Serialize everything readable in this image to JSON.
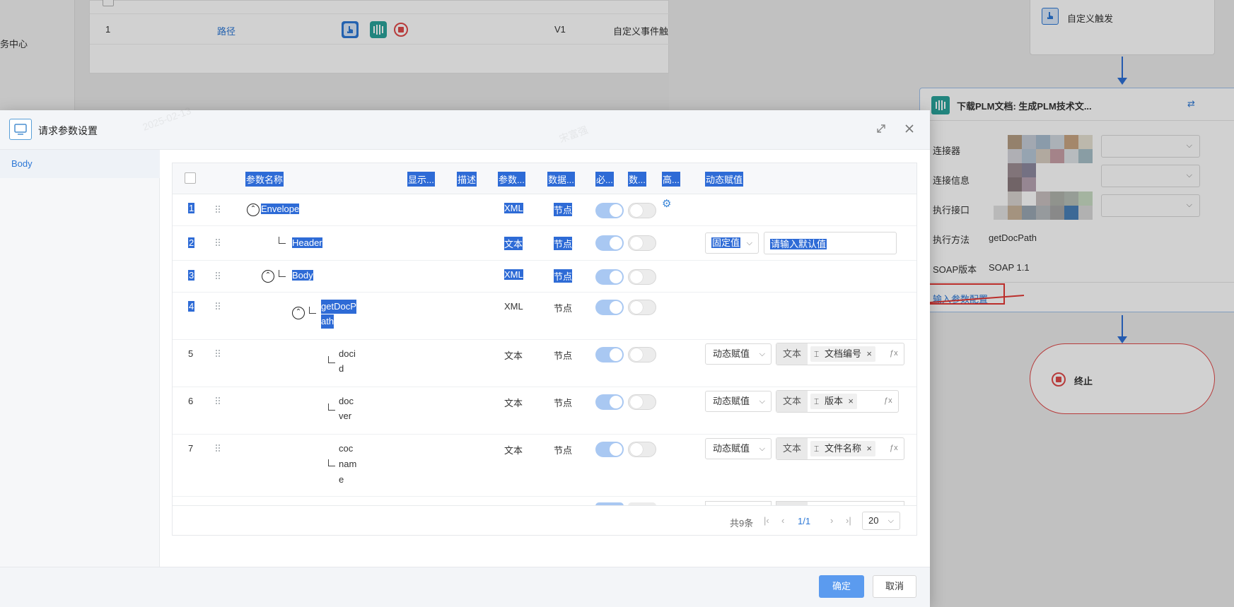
{
  "background": {
    "sidebar_text": "务中心",
    "table_row": {
      "index": "1",
      "name": "路径",
      "version": "V1",
      "trigger": "自定义事件触"
    },
    "flow": {
      "trigger_node": "自定义触发",
      "download_node": "下载PLM文档: 生成PLM技术文...",
      "fields": [
        {
          "label": "连接器",
          "value": ""
        },
        {
          "label": "连接信息",
          "value": ""
        },
        {
          "label": "执行接口",
          "value": ""
        },
        {
          "label": "执行方法",
          "value": "getDocPath"
        },
        {
          "label": "SOAP版本",
          "value": "SOAP 1.1"
        }
      ],
      "input_config_link": "输入参数配置",
      "end_node": "终止"
    }
  },
  "modal": {
    "title": "请求参数设置",
    "left_nav": [
      "Body"
    ],
    "columns": [
      "参数名称",
      "显示...",
      "描述",
      "参数...",
      "数据...",
      "必...",
      "数...",
      "高...",
      "动态赋值"
    ],
    "rows": [
      {
        "index": "1",
        "name": "Envelope",
        "param_type": "XML",
        "data_type": "节点",
        "expand": "⌃",
        "selected": true,
        "gear": true
      },
      {
        "index": "2",
        "name": "Header",
        "param_type": "文本",
        "data_type": "节点",
        "selected": true,
        "value_mode": "固定值",
        "default_placeholder": "请输入默认值"
      },
      {
        "index": "3",
        "name": "Body",
        "param_type": "XML",
        "data_type": "节点",
        "expand": "⌃",
        "selected": true
      },
      {
        "index": "4",
        "name_lines": [
          "getDocP",
          "ath"
        ],
        "param_type": "XML",
        "data_type": "节点",
        "expand": "⌃",
        "selected": true
      },
      {
        "index": "5",
        "name_lines": [
          "doci",
          "d"
        ],
        "param_type": "文本",
        "data_type": "节点",
        "value_mode": "动态赋值",
        "value_type": "文本",
        "value_tag": "文档编号"
      },
      {
        "index": "6",
        "name_lines": [
          "doc",
          "ver"
        ],
        "param_type": "文本",
        "data_type": "节点",
        "value_mode": "动态赋值",
        "value_type": "文本",
        "value_tag": "版本"
      },
      {
        "index": "7",
        "name_lines": [
          "coc",
          "nam",
          "e"
        ],
        "param_type": "文本",
        "data_type": "节点",
        "value_mode": "动态赋值",
        "value_type": "文本",
        "value_tag": "文件名称"
      }
    ],
    "pagination": {
      "total": "共9条",
      "page": "1/1",
      "page_size": "20"
    },
    "ok_label": "确定",
    "cancel_label": "取消"
  },
  "watermark": {
    "date": "2025-02-13",
    "name": "宋富强"
  },
  "colors": {
    "selection": "#2e6bd6",
    "accent": "#5b9bef",
    "annotation": "#e53935"
  },
  "icons": [
    "monitor-icon",
    "maximize-icon",
    "close-icon",
    "drag-handle-icon",
    "gear-icon",
    "chevron-down-icon",
    "text-cursor-icon",
    "function-icon",
    "first-page-icon",
    "prev-page-icon",
    "next-page-icon",
    "last-page-icon",
    "hand-pointer-icon",
    "stop-icon"
  ]
}
